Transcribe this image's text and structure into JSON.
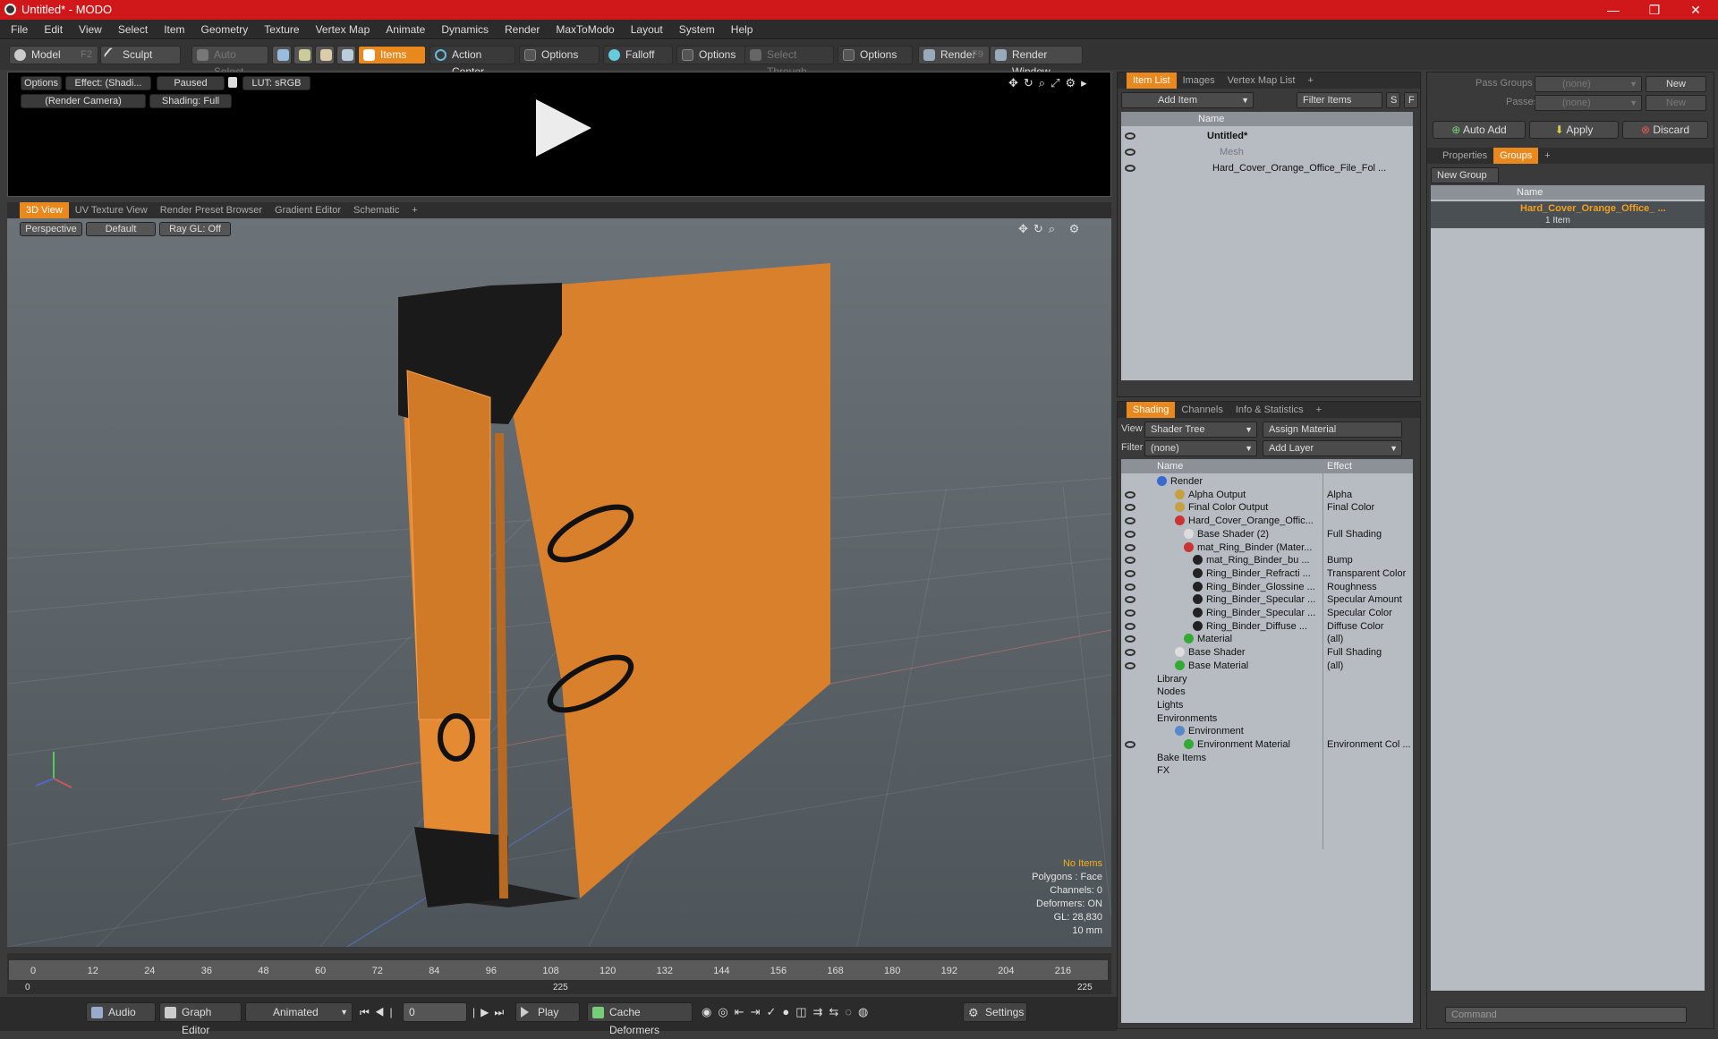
{
  "window": {
    "title": "Untitled* - MODO",
    "min": "—",
    "max": "❐",
    "close": "✕"
  },
  "menu": [
    "File",
    "Edit",
    "View",
    "Select",
    "Item",
    "Geometry",
    "Texture",
    "Vertex Map",
    "Animate",
    "Dynamics",
    "Render",
    "MaxToModo",
    "Layout",
    "System",
    "Help"
  ],
  "toolbar": {
    "model": "Model",
    "model_key": "F2",
    "sculpt": "Sculpt",
    "auto_select": "Auto Select",
    "items": "Items",
    "action_center": "Action Center",
    "options1": "Options",
    "falloff": "Falloff",
    "options2": "Options",
    "select_through": "Select Through",
    "options3": "Options",
    "render": "Render",
    "render_key": "F9",
    "render_window": "Render Window"
  },
  "render_preview": {
    "options": "Options",
    "effect": "Effect: (Shadi...",
    "paused": "Paused",
    "lut": "LUT: sRGB",
    "camera": "(Render Camera)",
    "shading": "Shading: Full"
  },
  "view_tabs": [
    "3D View",
    "UV Texture View",
    "Render Preset Browser",
    "Gradient Editor",
    "Schematic",
    "+"
  ],
  "viewport": {
    "perspective": "Perspective",
    "default": "Default",
    "raygl": "Ray GL: Off",
    "hud": [
      "No Items",
      "Polygons : Face",
      "Channels: 0",
      "Deformers: ON",
      "GL: 28,830",
      "10 mm"
    ]
  },
  "timeline": {
    "ticks": [
      "0",
      "12",
      "24",
      "36",
      "48",
      "60",
      "72",
      "84",
      "96",
      "108",
      "120",
      "132",
      "144",
      "156",
      "168",
      "180",
      "192",
      "204",
      "216"
    ],
    "start": "0",
    "mid": "225",
    "end": "225"
  },
  "bottom": {
    "audio": "Audio",
    "graph": "Graph Editor",
    "animated": "Animated",
    "frame": "0",
    "play": "Play",
    "cache": "Cache Deformers",
    "settings": "Settings"
  },
  "itemlist": {
    "tabs": [
      "Item List",
      "Images",
      "Vertex Map List",
      "+"
    ],
    "add_item": "Add Item",
    "filter": "Filter Items",
    "f": "F",
    "s": "S",
    "name_header": "Name",
    "rows": [
      "Untitled*",
      "Mesh",
      "Hard_Cover_Orange_Office_File_Fol ..."
    ]
  },
  "shading": {
    "tabs": [
      "Shading",
      "Channels",
      "Info & Statistics",
      "+"
    ],
    "view_label": "View",
    "view_value": "Shader Tree",
    "assign": "Assign Material",
    "filter_label": "Filter",
    "filter_value": "(none)",
    "add_layer": "Add Layer",
    "name_header": "Name",
    "effect_header": "Effect",
    "rows": [
      {
        "name": "Render",
        "effect": ""
      },
      {
        "name": "Alpha Output",
        "effect": "Alpha"
      },
      {
        "name": "Final Color Output",
        "effect": "Final Color"
      },
      {
        "name": "Hard_Cover_Orange_Offic...",
        "effect": ""
      },
      {
        "name": "Base Shader (2)",
        "effect": "Full Shading"
      },
      {
        "name": "mat_Ring_Binder (Mater...",
        "effect": ""
      },
      {
        "name": "mat_Ring_Binder_bu ...",
        "effect": "Bump"
      },
      {
        "name": "Ring_Binder_Refracti ...",
        "effect": "Transparent Color"
      },
      {
        "name": "Ring_Binder_Glossine ...",
        "effect": "Roughness"
      },
      {
        "name": "Ring_Binder_Specular ...",
        "effect": "Specular Amount"
      },
      {
        "name": "Ring_Binder_Specular ...",
        "effect": "Specular Color"
      },
      {
        "name": "Ring_Binder_Diffuse ...",
        "effect": "Diffuse Color"
      },
      {
        "name": "Material",
        "effect": "(all)"
      },
      {
        "name": "Base Shader",
        "effect": "Full Shading"
      },
      {
        "name": "Base Material",
        "effect": "(all)"
      },
      {
        "name": "Library",
        "effect": ""
      },
      {
        "name": "Nodes",
        "effect": ""
      },
      {
        "name": "Lights",
        "effect": ""
      },
      {
        "name": "Environments",
        "effect": ""
      },
      {
        "name": "Environment",
        "effect": ""
      },
      {
        "name": "Environment Material",
        "effect": "Environment Col ..."
      },
      {
        "name": "Bake Items",
        "effect": ""
      },
      {
        "name": "FX",
        "effect": ""
      }
    ]
  },
  "groups": {
    "pass_groups": "Pass Groups",
    "passes": "Passes",
    "none1": "(none)",
    "none2": "(none)",
    "new1": "New",
    "new2": "New",
    "auto_add": "Auto Add",
    "apply": "Apply",
    "discard": "Discard",
    "tabs": [
      "Properties",
      "Groups",
      "+"
    ],
    "new_group": "New Group",
    "name_header": "Name",
    "group_name": "Hard_Cover_Orange_Office_ ...",
    "group_count": "1 Item",
    "command": "Command"
  },
  "colors": {
    "accent": "#e9891d",
    "title": "#d0181b",
    "binder": "#e08a30"
  }
}
